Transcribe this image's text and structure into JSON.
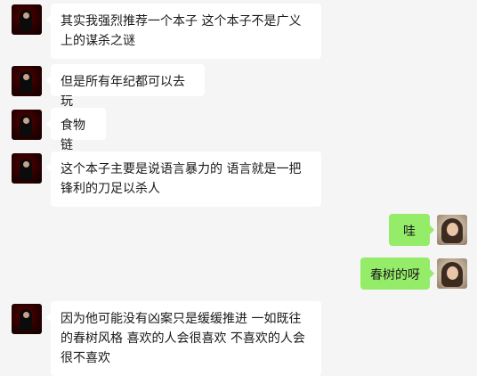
{
  "messages": [
    {
      "side": "left",
      "text": "其实我强烈推荐一个本子 这个本子不是广义上的谋杀之谜"
    },
    {
      "side": "left",
      "text": "但是所有年纪都可以去玩"
    },
    {
      "side": "left",
      "text": "食物链"
    },
    {
      "side": "left",
      "text": "这个本子主要是说语言暴力的 语言就是一把锋利的刀足以杀人"
    },
    {
      "side": "right",
      "text": "哇"
    },
    {
      "side": "right",
      "text": "春树的呀"
    },
    {
      "side": "left",
      "text": "因为他可能没有凶案只是缓缓推进 一如既往的春树风格 喜欢的人会很喜欢 不喜欢的人会很不喜欢"
    }
  ],
  "colors": {
    "background": "#f5f5f5",
    "incoming_bubble": "#ffffff",
    "outgoing_bubble": "#95ec69"
  },
  "icons": {
    "left_avatar": "contact-avatar",
    "right_avatar": "self-avatar"
  }
}
